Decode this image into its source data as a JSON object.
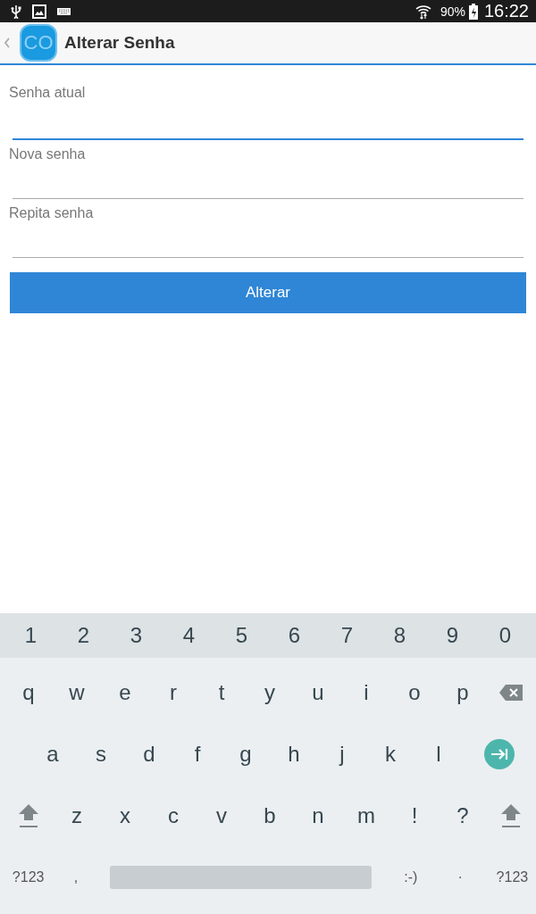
{
  "status_bar": {
    "battery": "90%",
    "time": "16:22"
  },
  "app_bar": {
    "logo": "CO",
    "title": "Alterar Senha"
  },
  "fields": [
    {
      "label": "Senha atual",
      "focused": true
    },
    {
      "label": "Nova senha",
      "focused": false
    },
    {
      "label": "Repita senha",
      "focused": false
    }
  ],
  "submit_button": "Alterar",
  "keyboard": {
    "number_row": [
      "1",
      "2",
      "3",
      "4",
      "5",
      "6",
      "7",
      "8",
      "9",
      "0"
    ],
    "rows": [
      [
        {
          "kind": "char",
          "label": "q"
        },
        {
          "kind": "char",
          "label": "w"
        },
        {
          "kind": "char",
          "label": "e"
        },
        {
          "kind": "char",
          "label": "r"
        },
        {
          "kind": "char",
          "label": "t"
        },
        {
          "kind": "char",
          "label": "y"
        },
        {
          "kind": "char",
          "label": "u"
        },
        {
          "kind": "char",
          "label": "i"
        },
        {
          "kind": "char",
          "label": "o"
        },
        {
          "kind": "char",
          "label": "p"
        },
        {
          "kind": "backspace"
        }
      ],
      [
        {
          "kind": "char",
          "label": "a"
        },
        {
          "kind": "char",
          "label": "s"
        },
        {
          "kind": "char",
          "label": "d"
        },
        {
          "kind": "char",
          "label": "f"
        },
        {
          "kind": "char",
          "label": "g"
        },
        {
          "kind": "char",
          "label": "h"
        },
        {
          "kind": "char",
          "label": "j"
        },
        {
          "kind": "char",
          "label": "k"
        },
        {
          "kind": "char",
          "label": "l"
        },
        {
          "kind": "go"
        }
      ],
      [
        {
          "kind": "shift"
        },
        {
          "kind": "char",
          "label": "z"
        },
        {
          "kind": "char",
          "label": "x"
        },
        {
          "kind": "char",
          "label": "c"
        },
        {
          "kind": "char",
          "label": "v"
        },
        {
          "kind": "char",
          "label": "b"
        },
        {
          "kind": "char",
          "label": "n"
        },
        {
          "kind": "char",
          "label": "m"
        },
        {
          "kind": "char",
          "label": "!"
        },
        {
          "kind": "char",
          "label": "?"
        },
        {
          "kind": "shift"
        }
      ]
    ],
    "bottom_row": [
      {
        "kind": "mode",
        "label": "?123"
      },
      {
        "kind": "char",
        "label": ","
      },
      {
        "kind": "space"
      },
      {
        "kind": "char",
        "label": ":-)"
      },
      {
        "kind": "char",
        "label": "·"
      },
      {
        "kind": "mode",
        "label": "?123"
      }
    ]
  }
}
